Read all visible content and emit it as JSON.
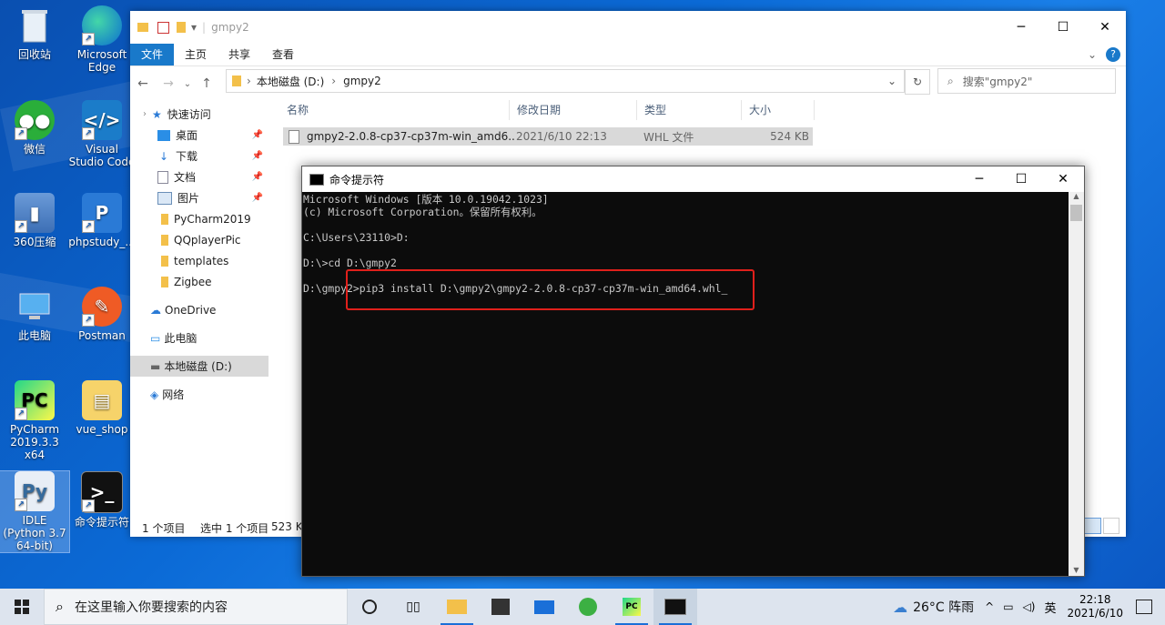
{
  "desktop": {
    "icons": [
      {
        "label": "回收站"
      },
      {
        "label": "Microsoft Edge"
      },
      {
        "label": "微信"
      },
      {
        "label": "Visual Studio Code"
      },
      {
        "label": "360压缩"
      },
      {
        "label": "phpstudy_..."
      },
      {
        "label": "此电脑"
      },
      {
        "label": "Postman"
      },
      {
        "label": "PyCharm 2019.3.3 x64"
      },
      {
        "label": "vue_shop"
      },
      {
        "label": "IDLE (Python 3.7 64-bit)"
      },
      {
        "label": "命令提示符"
      }
    ]
  },
  "explorer": {
    "title": "gmpy2",
    "ribbon_tabs": [
      "文件",
      "主页",
      "共享",
      "查看"
    ],
    "address_path": [
      "本地磁盘 (D:)",
      "gmpy2"
    ],
    "search_placeholder": "搜索\"gmpy2\"",
    "nav": {
      "quick_access": "快速访问",
      "items": [
        "桌面",
        "下载",
        "文档",
        "图片",
        "PyCharm2019",
        "QQplayerPic",
        "templates",
        "Zigbee"
      ],
      "onedrive": "OneDrive",
      "this_pc": "此电脑",
      "local_disk": "本地磁盘 (D:)",
      "network": "网络"
    },
    "columns": [
      "名称",
      "修改日期",
      "类型",
      "大小"
    ],
    "file": {
      "name": "gmpy2-2.0.8-cp37-cp37m-win_amd6...",
      "modified": "2021/6/10 22:13",
      "type": "WHL 文件",
      "size": "524 KB"
    },
    "status": {
      "count": "1 个项目",
      "selected": "选中 1 个项目",
      "size": "523 K"
    }
  },
  "cmd": {
    "title": "命令提示符",
    "lines": [
      "Microsoft Windows [版本 10.0.19042.1023]",
      "(c) Microsoft Corporation。保留所有权利。",
      "",
      "C:\\Users\\23110>D:",
      "",
      "D:\\>cd D:\\gmpy2",
      "",
      "D:\\gmpy2>pip3 install D:\\gmpy2\\gmpy2-2.0.8-cp37-cp37m-win_amd64.whl"
    ]
  },
  "taskbar": {
    "search_placeholder": "在这里输入你要搜索的内容",
    "weather": "26°C 阵雨",
    "ime": "英",
    "time": "22:18",
    "date": "2021/6/10"
  },
  "colors": {
    "accent": "#1979ca",
    "highlight_box": "#e0201b",
    "console_bg": "#0c0c0c"
  }
}
